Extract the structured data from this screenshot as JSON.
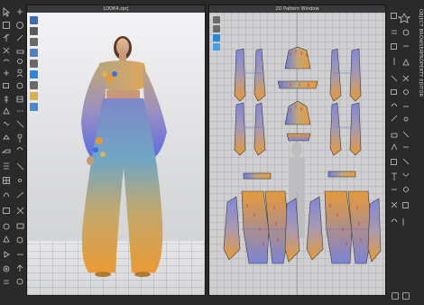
{
  "window3d": {
    "title": "LOOK4.zprj"
  },
  "window2d": {
    "title": "2D Pattern Window"
  },
  "tabs": {
    "object_browser": "OBJECT BROWSER",
    "property_editor": "PROPERTY EDITOR"
  },
  "icons": {
    "tool": "tool-icon",
    "avatar": "avatar-icon",
    "pattern": "pattern-icon"
  },
  "colors": {
    "garment_top": "#5f7fd0",
    "garment_mid": "#c7a86a",
    "garment_bottom": "#e39a3a",
    "stitch_red": "#d23a3a",
    "accent_blue": "#2f86d8"
  }
}
